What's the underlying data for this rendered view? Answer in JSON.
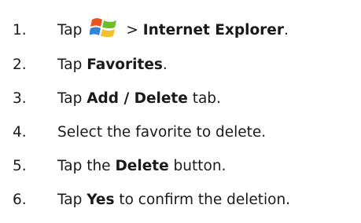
{
  "steps": [
    {
      "number": "1.",
      "parts": [
        {
          "t": "Tap",
          "bold": false
        },
        {
          "icon": "windows-start-icon"
        },
        {
          "t": "> ",
          "bold": false
        },
        {
          "t": "Internet Explorer",
          "bold": true
        },
        {
          "t": ".",
          "bold": false
        }
      ]
    },
    {
      "number": "2.",
      "parts": [
        {
          "t": "Tap ",
          "bold": false
        },
        {
          "t": "Favorites",
          "bold": true
        },
        {
          "t": ".",
          "bold": false
        }
      ]
    },
    {
      "number": "3.",
      "parts": [
        {
          "t": "Tap ",
          "bold": false
        },
        {
          "t": "Add / Delete",
          "bold": true
        },
        {
          "t": " tab.",
          "bold": false
        }
      ]
    },
    {
      "number": "4.",
      "parts": [
        {
          "t": "Select the favorite to delete.",
          "bold": false
        }
      ]
    },
    {
      "number": "5.",
      "parts": [
        {
          "t": "Tap the ",
          "bold": false
        },
        {
          "t": "Delete",
          "bold": true
        },
        {
          "t": " button.",
          "bold": false
        }
      ]
    },
    {
      "number": "6.",
      "parts": [
        {
          "t": "Tap ",
          "bold": false
        },
        {
          "t": "Yes",
          "bold": true
        },
        {
          "t": " to confirm the deletion.",
          "bold": false
        }
      ]
    }
  ],
  "colors": {
    "text": "#1a1a1a",
    "windows_red": "#e8541b",
    "windows_green": "#6cbf2a",
    "windows_blue": "#2f86d6",
    "windows_yellow": "#f6c12c"
  }
}
